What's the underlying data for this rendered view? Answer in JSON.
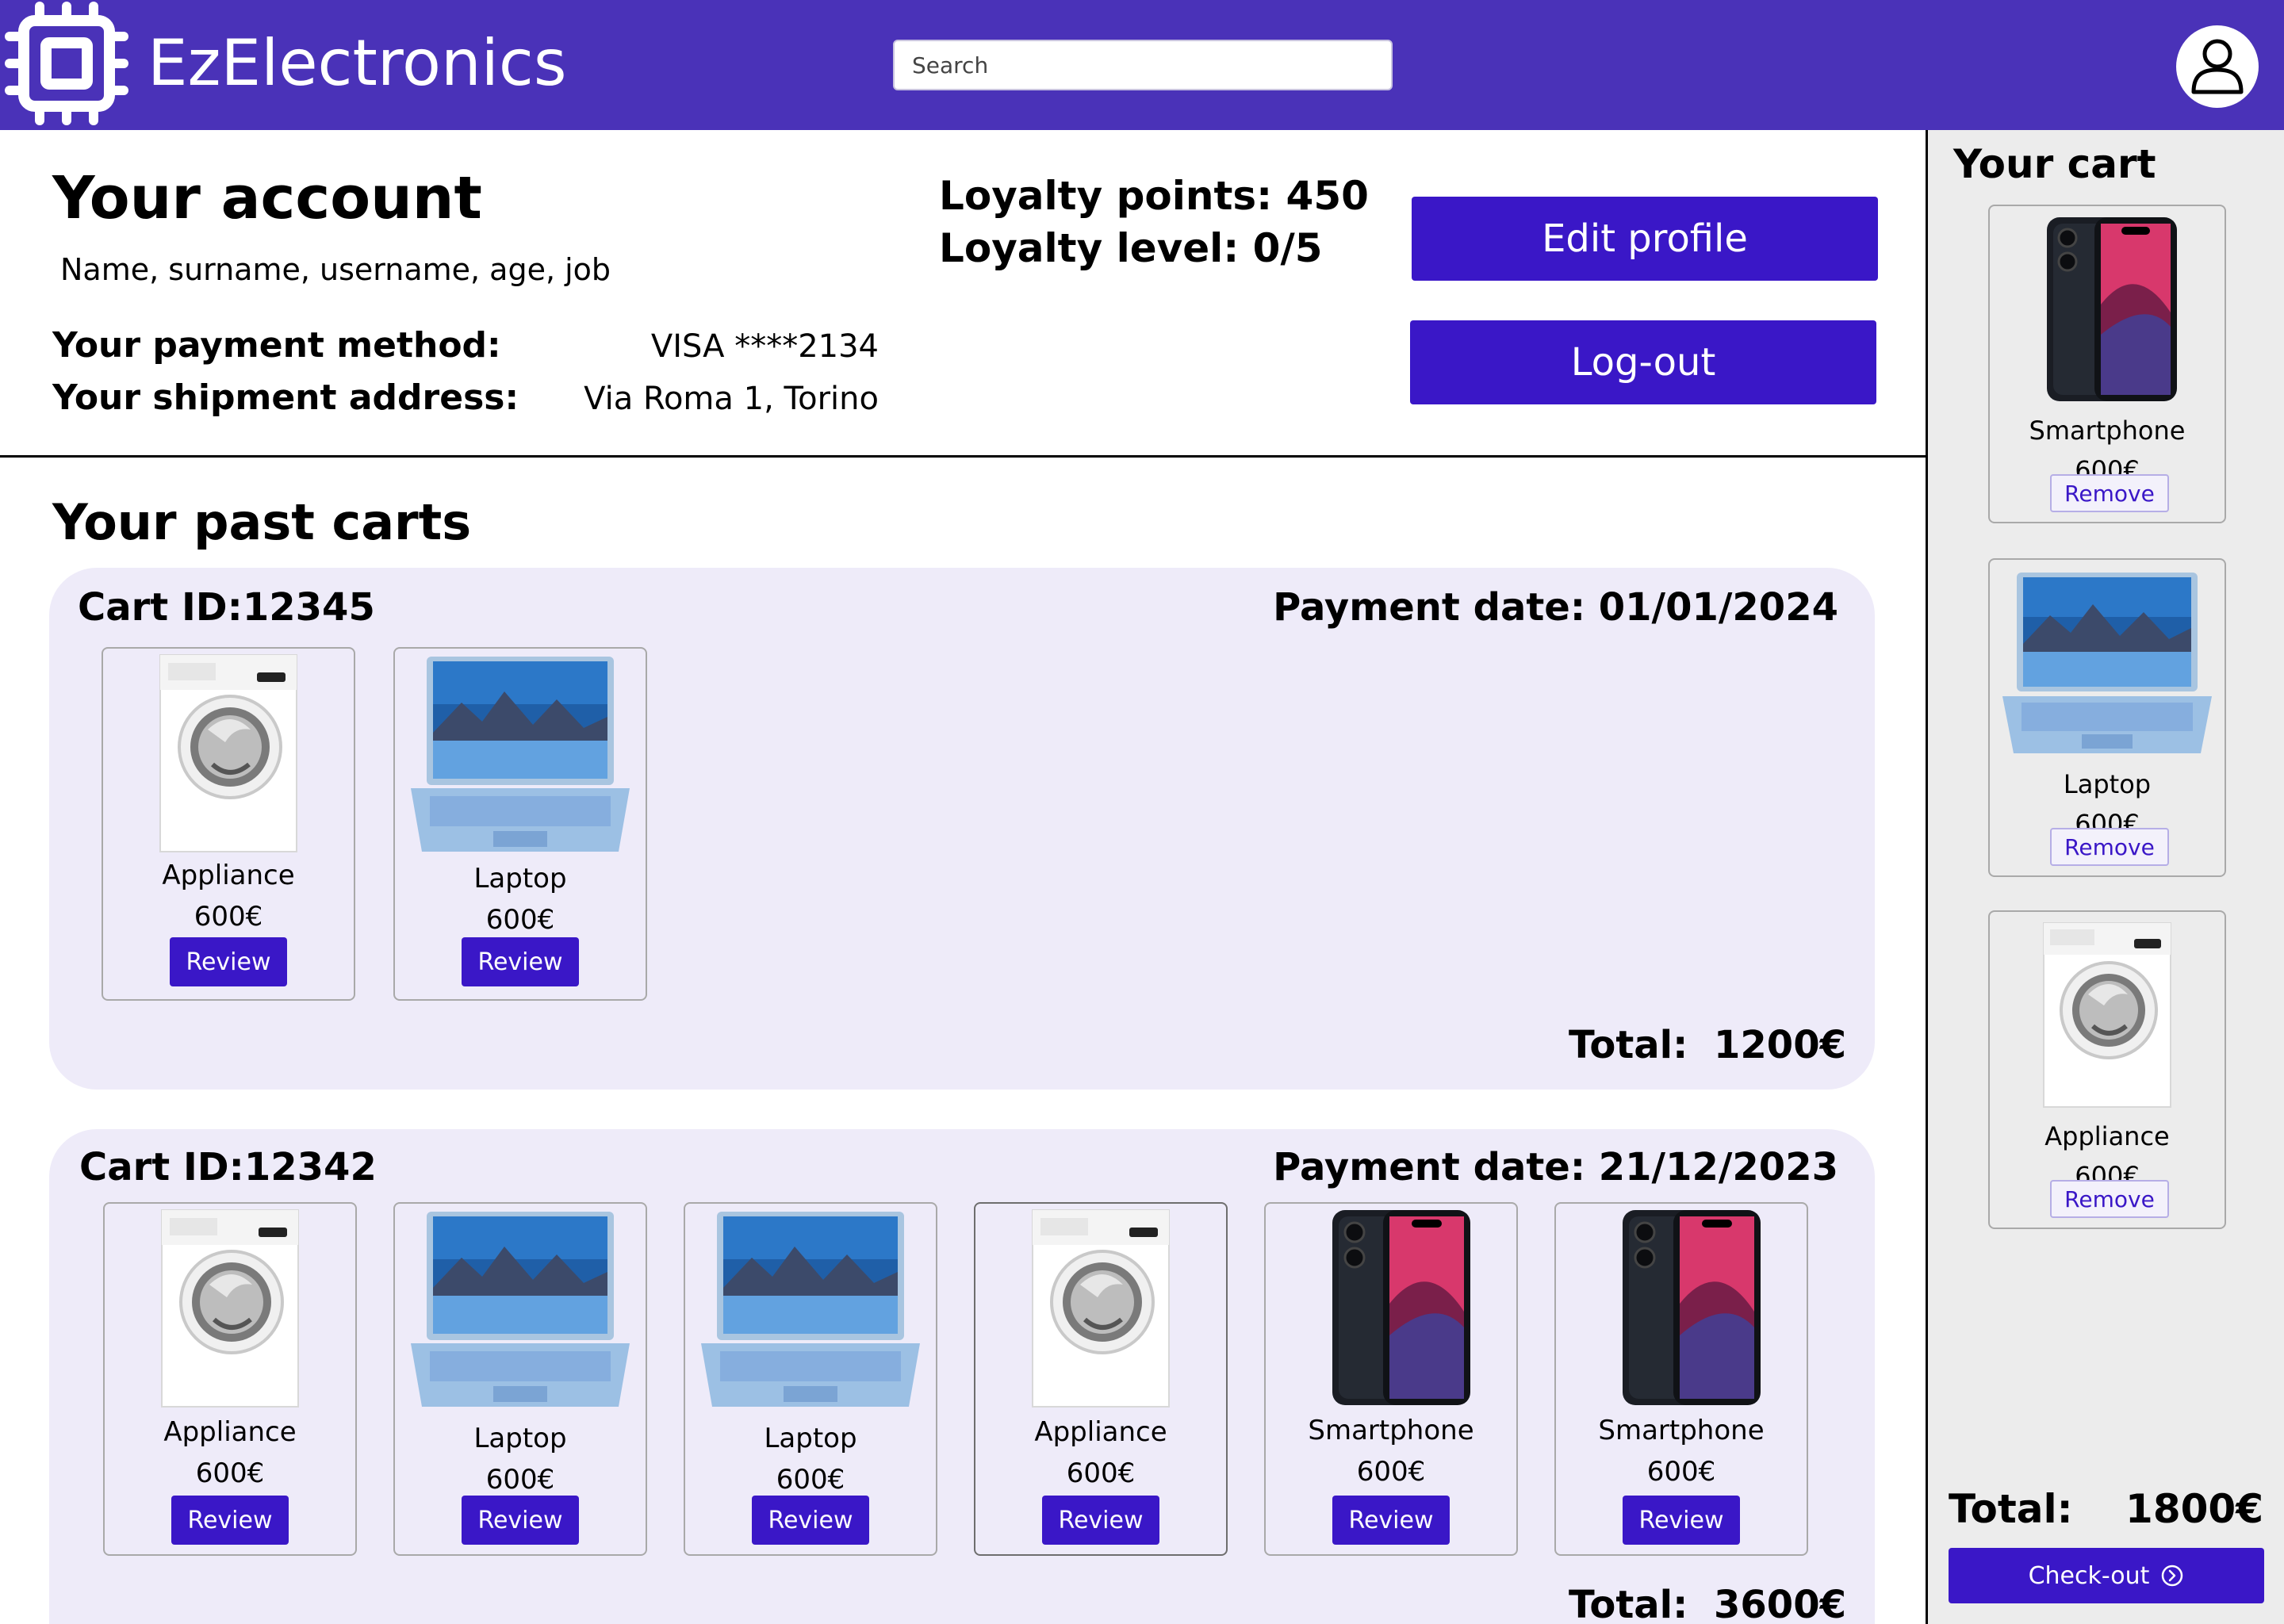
{
  "header": {
    "brand": "EzElectronics",
    "logo_icon": "chip-icon",
    "search_placeholder": "Search",
    "avatar_icon": "user-icon",
    "bg_color": "#4a32b8"
  },
  "account": {
    "title": "Your account",
    "subtitle": "Name, surname, username, age, job",
    "payment_label": "Your payment method:",
    "payment_value": "VISA ****2134",
    "address_label": "Your shipment address:",
    "address_value": "Via Roma 1, Torino",
    "loyalty_points": "Loyalty points: 450",
    "loyalty_level": "Loyalty level: 0/5",
    "edit_profile_label": "Edit profile",
    "logout_label": "Log-out"
  },
  "past_carts": {
    "title": "Your past carts",
    "total_label": "Total:",
    "review_label": "Review",
    "carts": [
      {
        "id": "Cart ID:12345",
        "date": "Payment date: 01/01/2024",
        "total": "1200€",
        "items": [
          {
            "name": "Appliance",
            "price": "600€",
            "image": "washing-machine"
          },
          {
            "name": "Laptop",
            "price": "600€",
            "image": "laptop"
          }
        ]
      },
      {
        "id": "Cart ID:12342",
        "date": "Payment date: 21/12/2023",
        "total": "3600€",
        "items": [
          {
            "name": "Appliance",
            "price": "600€",
            "image": "washing-machine"
          },
          {
            "name": "Laptop",
            "price": "600€",
            "image": "laptop"
          },
          {
            "name": "Laptop",
            "price": "600€",
            "image": "laptop"
          },
          {
            "name": "Appliance",
            "price": "600€",
            "image": "washing-machine"
          },
          {
            "name": "Smartphone",
            "price": "600€",
            "image": "smartphone"
          },
          {
            "name": "Smartphone",
            "price": "600€",
            "image": "smartphone"
          }
        ]
      }
    ]
  },
  "cart": {
    "title": "Your cart",
    "remove_label": "Remove",
    "total_label": "Total:",
    "total_value": "1800€",
    "checkout_label": "Check-out",
    "checkout_icon": "arrow-circle-right-icon",
    "items": [
      {
        "name": "Smartphone",
        "price": "600€",
        "image": "smartphone"
      },
      {
        "name": "Laptop",
        "price": "600€",
        "image": "laptop"
      },
      {
        "name": "Appliance",
        "price": "600€",
        "image": "washing-machine"
      }
    ]
  },
  "colors": {
    "accent": "#3a17c7",
    "header": "#4a32b8",
    "cart_panel": "#eeebf9",
    "sidebar": "#ececec"
  }
}
